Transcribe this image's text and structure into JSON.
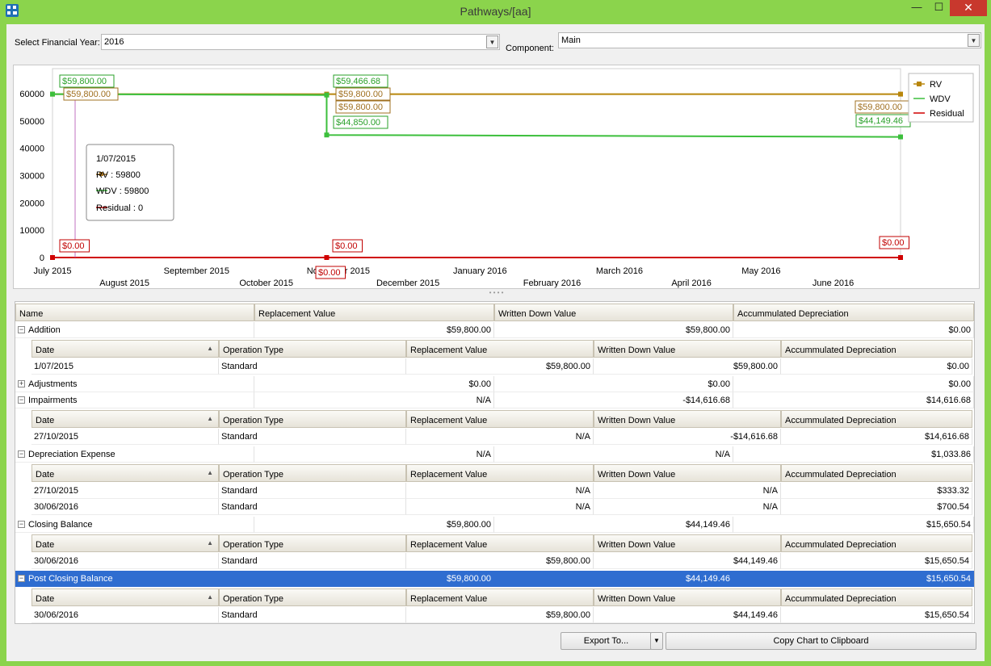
{
  "window": {
    "title": "Pathways/[aa]",
    "min": "—",
    "max": "☐",
    "close": "✕"
  },
  "filters": {
    "year_label": "Select Financial Year:",
    "year_value": "2016",
    "component_label": "Component:",
    "component_value": "Main"
  },
  "chart_data": {
    "type": "line",
    "x_dates": [
      "2015-07-01",
      "2015-10-27",
      "2016-06-30"
    ],
    "series": [
      {
        "name": "RV",
        "color": "#b8860b",
        "x": [
          "2015-07-01",
          "2015-10-27",
          "2016-06-30"
        ],
        "values": [
          59800,
          59800,
          59800
        ]
      },
      {
        "name": "WDV",
        "color": "#3cbf3c",
        "x": [
          "2015-07-01",
          "2015-10-27",
          "2015-10-27",
          "2016-06-30"
        ],
        "values": [
          59800,
          59466.68,
          44850,
          44149.46
        ]
      },
      {
        "name": "Residual",
        "color": "#d00000",
        "x": [
          "2015-07-01",
          "2015-10-27",
          "2016-06-30"
        ],
        "values": [
          0,
          0,
          0
        ]
      }
    ],
    "ylim": [
      0,
      65000
    ],
    "yticks": [
      "0",
      "10000",
      "20000",
      "30000",
      "40000",
      "50000",
      "60000"
    ],
    "xticks_top": [
      "July 2015",
      "September 2015",
      "November 2015",
      "January 2016",
      "March 2016",
      "May 2016"
    ],
    "xticks_bottom": [
      "August 2015",
      "October 2015",
      "December 2015",
      "February 2016",
      "April 2016",
      "June 2016"
    ],
    "legend": [
      "RV",
      "WDV",
      "Residual"
    ],
    "legend_position": "top-right",
    "labels": {
      "wdv_start": "$59,800.00",
      "rv_start": "$59,800.00",
      "res_start": "$0.00",
      "wdv_mid_top": "$59,466.68",
      "rv_mid_a": "$59,800.00",
      "rv_mid_b": "$59,800.00",
      "wdv_mid_low": "$44,850.00",
      "res_mid_a": "$0.00",
      "res_mid_b": "$0.00",
      "rv_end": "$59,800.00",
      "wdv_end": "$44,149.46",
      "res_end": "$0.00"
    },
    "tooltip": {
      "date": "1/07/2015",
      "rv": "RV : 59800",
      "wdv": "WDV : 59800",
      "residual": "Residual : 0"
    }
  },
  "grid": {
    "columns": [
      "Name",
      "Replacement Value",
      "Written Down Value",
      "Accummulated Depreciation"
    ],
    "sub_columns": [
      "Date",
      "Operation Type",
      "Replacement Value",
      "Written Down Value",
      "Accummulated Depreciation"
    ],
    "groups": [
      {
        "name": "Addition",
        "expander": "−",
        "rv": "$59,800.00",
        "wdv": "$59,800.00",
        "ad": "$0.00",
        "details": [
          {
            "date": "1/07/2015",
            "type": "Standard",
            "rv": "$59,800.00",
            "wdv": "$59,800.00",
            "ad": "$0.00"
          }
        ]
      },
      {
        "name": "Adjustments",
        "expander": "+",
        "rv": "$0.00",
        "wdv": "$0.00",
        "ad": "$0.00",
        "details": []
      },
      {
        "name": "Impairments",
        "expander": "−",
        "rv": "N/A",
        "wdv": "-$14,616.68",
        "ad": "$14,616.68",
        "details": [
          {
            "date": "27/10/2015",
            "type": "Standard",
            "rv": "N/A",
            "wdv": "-$14,616.68",
            "ad": "$14,616.68"
          }
        ]
      },
      {
        "name": "Depreciation Expense",
        "expander": "−",
        "rv": "N/A",
        "wdv": "N/A",
        "ad": "$1,033.86",
        "details": [
          {
            "date": "27/10/2015",
            "type": "Standard",
            "rv": "N/A",
            "wdv": "N/A",
            "ad": "$333.32"
          },
          {
            "date": "30/06/2016",
            "type": "Standard",
            "rv": "N/A",
            "wdv": "N/A",
            "ad": "$700.54"
          }
        ]
      },
      {
        "name": "Closing Balance",
        "expander": "−",
        "rv": "$59,800.00",
        "wdv": "$44,149.46",
        "ad": "$15,650.54",
        "details": [
          {
            "date": "30/06/2016",
            "type": "Standard",
            "rv": "$59,800.00",
            "wdv": "$44,149.46",
            "ad": "$15,650.54"
          }
        ]
      },
      {
        "name": "Post Closing Balance",
        "expander": "−",
        "selected": true,
        "rv": "$59,800.00",
        "wdv": "$44,149.46",
        "ad": "$15,650.54",
        "details": [
          {
            "date": "30/06/2016",
            "type": "Standard",
            "rv": "$59,800.00",
            "wdv": "$44,149.46",
            "ad": "$15,650.54"
          }
        ]
      }
    ]
  },
  "buttons": {
    "export": "Export To...",
    "export_dd": "▼",
    "copy": "Copy Chart to Clipboard"
  }
}
